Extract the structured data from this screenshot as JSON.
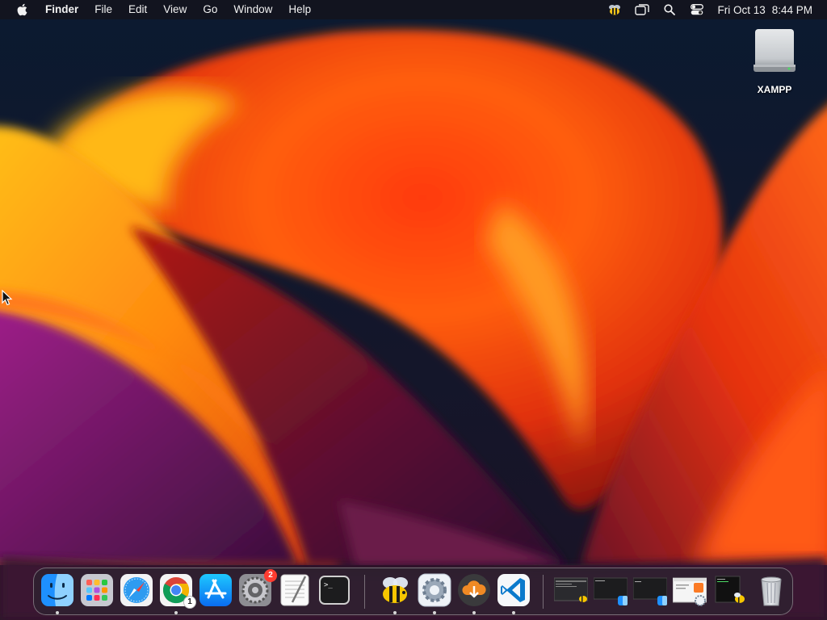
{
  "menubar": {
    "app_name": "Finder",
    "menus": [
      "File",
      "Edit",
      "View",
      "Go",
      "Window",
      "Help"
    ],
    "status_icons": [
      "bee-icon",
      "display-icon",
      "spotlight-search-icon",
      "control-center-icon"
    ],
    "date": "Fri Oct 13",
    "time": "8:44 PM"
  },
  "desktop": {
    "items": [
      {
        "label": "XAMPP",
        "icon": "external-drive-icon"
      }
    ]
  },
  "dock": {
    "apps": [
      {
        "name": "Finder",
        "icon": "finder-icon",
        "running": true
      },
      {
        "name": "Launchpad",
        "icon": "launchpad-icon",
        "running": false
      },
      {
        "name": "Safari",
        "icon": "safari-icon",
        "running": false
      },
      {
        "name": "Google Chrome",
        "icon": "chrome-icon",
        "running": true,
        "badge": "1"
      },
      {
        "name": "App Store",
        "icon": "app-store-icon",
        "running": false
      },
      {
        "name": "System Settings",
        "icon": "system-settings-icon",
        "running": false,
        "badge": "2"
      },
      {
        "name": "TextEdit",
        "icon": "textedit-icon",
        "running": false
      },
      {
        "name": "Terminal",
        "icon": "terminal-icon",
        "running": false
      },
      {
        "name": "Bee",
        "icon": "bee-app-icon",
        "running": true
      },
      {
        "name": "Settings",
        "icon": "gear-app-icon",
        "running": true
      },
      {
        "name": "Downloader",
        "icon": "cloud-download-icon",
        "running": true
      },
      {
        "name": "Visual Studio Code",
        "icon": "vscode-icon",
        "running": true
      }
    ],
    "minimized": [
      {
        "name": "window-thumbnail-1"
      },
      {
        "name": "window-thumbnail-2"
      },
      {
        "name": "window-thumbnail-3"
      },
      {
        "name": "window-thumbnail-4"
      },
      {
        "name": "window-thumbnail-5"
      }
    ],
    "trash": {
      "name": "Trash",
      "icon": "trash-icon"
    }
  }
}
